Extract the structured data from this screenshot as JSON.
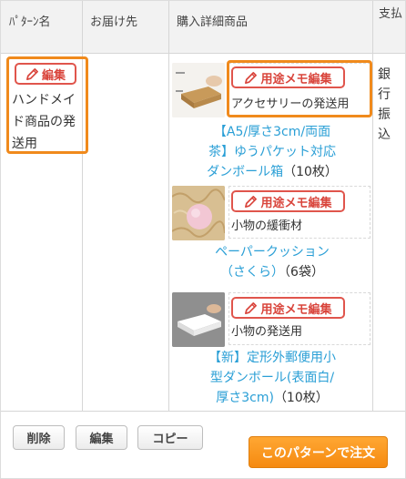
{
  "header": {
    "col_pattern": "ﾊﾟﾀｰﾝ名",
    "col_delivery": "お届け先",
    "col_products": "購入詳細商品",
    "col_payment": "支払"
  },
  "pattern": {
    "edit_label": "編集",
    "name": "ハンドメイド商品の発送用"
  },
  "memo_edit_label": "用途メモ編集",
  "products": [
    {
      "memo": "アクセサリーの発送用",
      "link": "【A5/厚さ3cm/両面茶】ゆうパケット対応ダンボール箱",
      "link_lines": [
        "【A5/厚さ3cm/両面",
        "茶】ゆうパケット対応",
        "ダンボール箱"
      ],
      "qty": "（10枚）"
    },
    {
      "memo": "小物の緩衝材",
      "link": "ペーパークッション（さくら）",
      "link_lines": [
        "ペーパークッション",
        "（さくら）"
      ],
      "qty": "（6袋）"
    },
    {
      "memo": "小物の発送用",
      "link": "【新】定形外郵便用小型ダンボール(表面白/厚さ3cm)",
      "link_lines": [
        "【新】定形外郵便用小",
        "型ダンボール(表面白/",
        "厚さ3cm)"
      ],
      "qty": "（10枚）"
    }
  ],
  "payment": "銀行振込",
  "footer": {
    "delete_label": "削除",
    "edit_label": "編集",
    "copy_label": "コピー",
    "order_label": "このパターンで注文"
  },
  "colors": {
    "highlight": "#f08a1c",
    "edit_red": "#e0554c",
    "link_blue": "#2a9fd6",
    "order_orange": "#f58a10"
  }
}
